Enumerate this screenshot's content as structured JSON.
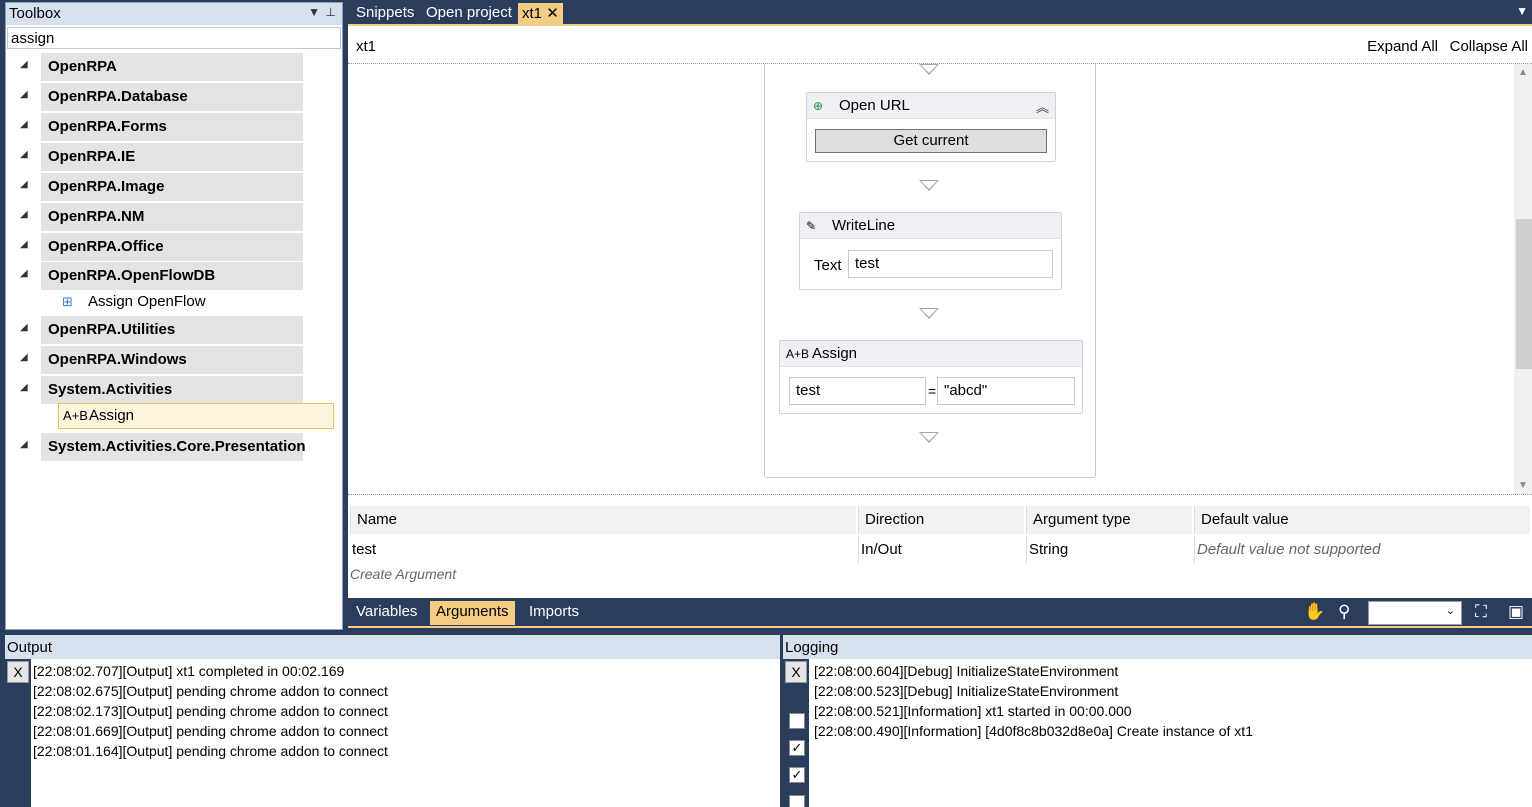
{
  "toolbox": {
    "title": "Toolbox",
    "search_value": "assign",
    "categories": [
      {
        "label": "OpenRPA"
      },
      {
        "label": "OpenRPA.Database"
      },
      {
        "label": "OpenRPA.Forms"
      },
      {
        "label": "OpenRPA.IE"
      },
      {
        "label": "OpenRPA.Image"
      },
      {
        "label": "OpenRPA.NM"
      },
      {
        "label": "OpenRPA.Office"
      },
      {
        "label": "OpenRPA.OpenFlowDB"
      },
      {
        "label": "OpenRPA.Utilities"
      },
      {
        "label": "OpenRPA.Windows"
      },
      {
        "label": "System.Activities"
      },
      {
        "label": "System.Activities.Core.Presentation"
      }
    ],
    "tools": {
      "assign_openflow": "Assign OpenFlow",
      "assign": "Assign"
    }
  },
  "tabs": [
    {
      "label": "Snippets"
    },
    {
      "label": "Open project"
    },
    {
      "label": "xt1"
    }
  ],
  "designer": {
    "title": "xt1",
    "expand_all": "Expand All",
    "collapse_all": "Collapse All",
    "activities": {
      "open_url": {
        "title": "Open URL",
        "button": "Get current"
      },
      "writeline": {
        "title": "WriteLine",
        "text_label": "Text",
        "text_value": "test"
      },
      "assign": {
        "title": "Assign",
        "to": "test",
        "eq": "=",
        "value": "\"abcd\""
      }
    }
  },
  "arguments": {
    "headers": {
      "name": "Name",
      "direction": "Direction",
      "type": "Argument type",
      "default": "Default value"
    },
    "rows": [
      {
        "name": "test",
        "direction": "In/Out",
        "type": "String",
        "default": "Default value not supported"
      }
    ],
    "create": "Create Argument"
  },
  "bottom_tabs": {
    "variables": "Variables",
    "arguments": "Arguments",
    "imports": "Imports"
  },
  "output": {
    "title": "Output",
    "clear": "X",
    "lines": [
      "[22:08:02.707][Output] xt1 completed in 00:02.169",
      "[22:08:02.675][Output] pending chrome addon to connect",
      "[22:08:02.173][Output] pending chrome addon to connect",
      "[22:08:01.669][Output] pending chrome addon to connect",
      "[22:08:01.164][Output] pending chrome addon to connect"
    ]
  },
  "logging": {
    "title": "Logging",
    "clear": "X",
    "lines": [
      "[22:08:00.604][Debug] InitializeStateEnvironment",
      "[22:08:00.523][Debug] InitializeStateEnvironment",
      "[22:08:00.521][Information] xt1 started in 00:00.000",
      "[22:08:00.490][Information] [4d0f8c8b032d8e0a] Create instance of xt1"
    ],
    "filters": [
      false,
      true,
      true,
      false,
      true
    ]
  },
  "colors": {
    "chrome": "#2b3d5c",
    "accent": "#f5cc84",
    "panel_title": "#d7e1ee"
  }
}
